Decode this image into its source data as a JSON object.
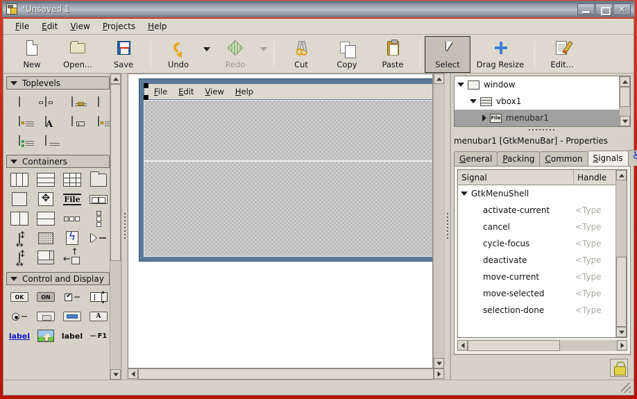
{
  "window": {
    "title": "*Unsaved 1",
    "icon": "glade-app-icon",
    "buttons": {
      "minimize": "Minimize",
      "maximize": "Maximize",
      "close": "Close"
    }
  },
  "menubar": {
    "items": [
      {
        "label": "File",
        "mnemonic": "F"
      },
      {
        "label": "Edit",
        "mnemonic": "E"
      },
      {
        "label": "View",
        "mnemonic": "V"
      },
      {
        "label": "Projects",
        "mnemonic": "P"
      },
      {
        "label": "Help",
        "mnemonic": "H"
      }
    ]
  },
  "toolbar": {
    "new_label": "New",
    "open_label": "Open...",
    "save_label": "Save",
    "undo_label": "Undo",
    "redo_label": "Redo",
    "cut_label": "Cut",
    "copy_label": "Copy",
    "paste_label": "Paste",
    "select_label": "Select",
    "drag_resize_label": "Drag Resize",
    "edit_label": "Edit...",
    "active_item": "Select",
    "disabled_items": [
      "Redo"
    ]
  },
  "palette": {
    "groups": [
      {
        "title": "Toplevels",
        "expanded": true,
        "items": [
          "window-widget",
          "dialog-widget",
          "message-dialog-widget",
          "color-selection-dialog-widget",
          "file-chooser-dialog-widget",
          "font-selection-dialog-widget",
          "input-dialog-widget",
          "about-dialog-widget",
          "assistant-widget",
          "offscreen-window-widget"
        ]
      },
      {
        "title": "Containers",
        "expanded": true,
        "items": [
          "hbox-widget",
          "vbox-widget",
          "table-widget",
          "notebook-widget",
          "frame-widget",
          "alignment-widget",
          "file-chooser-widget",
          "hbutton-box-widget",
          "hpaned-widget",
          "vpaned-widget",
          "hbutton-row-widget",
          "vbutton-column-widget",
          "fixed-widget",
          "layout-widget",
          "event-box-widget",
          "expander-widget",
          "aspect-frame-widget",
          "scrolled-window-widget",
          "viewport-widget"
        ]
      },
      {
        "title": "Control and Display",
        "expanded": true,
        "items": [
          "button-widget",
          "toggle-button-widget",
          "check-button-widget",
          "spin-button-widget",
          "radio-button-widget",
          "combo-box-widget",
          "entry-widget",
          "font-button-widget",
          "link-button-widget",
          "image-widget",
          "label-widget",
          "accel-label-widget"
        ],
        "item_labels": {
          "button": "OK",
          "toggle": "ON",
          "label_link": "label",
          "label_plain": "label",
          "accel": "F1"
        }
      }
    ]
  },
  "canvas": {
    "design_window": {
      "menubar": {
        "items": [
          {
            "label": "File",
            "mnemonic": "F"
          },
          {
            "label": "Edit",
            "mnemonic": "E"
          },
          {
            "label": "View",
            "mnemonic": "V"
          },
          {
            "label": "Help",
            "mnemonic": "H"
          }
        ],
        "selected": true
      },
      "placeholders": 2
    }
  },
  "inspector": {
    "tree": [
      {
        "label": "window",
        "indent": 0,
        "expander": "open",
        "icon": "window-icon",
        "selected": false
      },
      {
        "label": "vbox1",
        "indent": 1,
        "expander": "open",
        "icon": "vbox-icon",
        "selected": false
      },
      {
        "label": "menubar1",
        "indent": 2,
        "expander": "closed",
        "icon": "menubar-icon",
        "selected": true
      }
    ]
  },
  "properties": {
    "title": "menubar1 [GtkMenuBar] - Properties",
    "tabs": [
      {
        "label": "General",
        "mnemonic": "G",
        "active": false
      },
      {
        "label": "Packing",
        "mnemonic": "P",
        "active": false
      },
      {
        "label": "Common",
        "mnemonic": "C",
        "active": false
      },
      {
        "label": "Signals",
        "mnemonic": "S",
        "active": true
      }
    ],
    "accessibility_tab_icon": "accessibility-icon"
  },
  "signals": {
    "columns": [
      "Signal",
      "Handle"
    ],
    "rows": [
      {
        "name": "GtkMenuShell",
        "handler": "",
        "type": "group"
      },
      {
        "name": "activate-current",
        "handler": "<Type",
        "type": "signal"
      },
      {
        "name": "cancel",
        "handler": "<Type",
        "type": "signal"
      },
      {
        "name": "cycle-focus",
        "handler": "<Type",
        "type": "signal"
      },
      {
        "name": "deactivate",
        "handler": "<Type",
        "type": "signal"
      },
      {
        "name": "move-current",
        "handler": "<Type",
        "type": "signal"
      },
      {
        "name": "move-selected",
        "handler": "<Type",
        "type": "signal"
      },
      {
        "name": "selection-done",
        "handler": "<Type",
        "type": "signal"
      }
    ]
  },
  "lock_bar": {
    "lock_icon": "padlock-icon"
  },
  "statusbar": {
    "text": ""
  },
  "colors": {
    "frame_red": "#c81a0a",
    "chrome_grey": "#d6d2c8",
    "design_border_blue": "#5c7a99",
    "selection_grey": "#a0a0a0",
    "placeholder_grey": "#b9b9b9"
  }
}
